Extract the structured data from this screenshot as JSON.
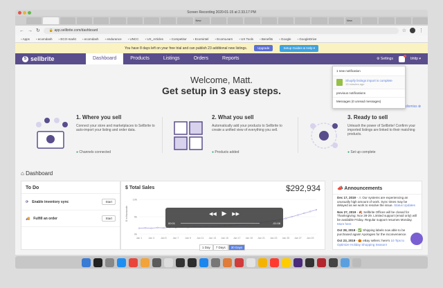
{
  "mac": {
    "window_title": "Screen Recording 2020-01-15 at 2.33.17 PM"
  },
  "browser": {
    "tabs": [
      "",
      "",
      "",
      "",
      "",
      "",
      "",
      "",
      "",
      "",
      "New",
      "",
      "",
      "",
      "",
      "",
      "",
      "",
      "",
      "New",
      "",
      "",
      "",
      ""
    ],
    "url": "app.sellbrite.com/dashboard",
    "bookmarks": [
      "Apps",
      "ecomdash",
      "ECO-markt",
      "ecomdash",
      "endurance",
      "UNCC",
      "UX_Articles",
      "Competitor",
      "Ecomintel",
      "EcomLearn",
      "UX Tools",
      "Benefits",
      "Google",
      "GoogleDrive"
    ]
  },
  "trial_banner": {
    "text": "You have 8 days left on your free trial and can publish 23 additional new listings.",
    "upgrade": "Upgrade",
    "setup": "Setup Guides & Help ▾"
  },
  "header": {
    "logo": "sellbrite",
    "nav": [
      "Dashboard",
      "Products",
      "Listings",
      "Orders",
      "Reports"
    ],
    "settings": "Settings",
    "user": "bhttp ▾"
  },
  "notifications": {
    "title": "1 new notification",
    "item": "Shopify listings import is complete",
    "item_time": "13 minutes ago",
    "link1": "previous notifications",
    "link2": "Messages (0 unread messages)",
    "dismiss": "dismiss ⊗"
  },
  "welcome": {
    "line1": "Welcome, Matt.",
    "line2": "Get setup in 3 easy steps."
  },
  "steps": [
    {
      "title": "1. Where you sell",
      "text": "Connect your store and marketplaces to Sellbrite to auto-import your listing and order data.",
      "status": "Channels connected"
    },
    {
      "title": "2. What you sell",
      "text": "Automatically add your products to Sellbrite to create a unified view of everything you sell.",
      "status": "Products added"
    },
    {
      "title": "3. Ready to sell",
      "text": "Unleash the power of Sellbrite! Confirm your imported listings are linked to their matching products.",
      "status": "Set up complete"
    }
  ],
  "dashboard": {
    "heading": "Dashboard"
  },
  "todo": {
    "title": "To Do",
    "items": [
      {
        "label": "Enable inventory sync",
        "button": "Start"
      },
      {
        "label": "Fulfill an order",
        "button": "Start"
      }
    ]
  },
  "sales": {
    "title": "$ Total Sales",
    "amount": "$292,934",
    "ylabel": "$ in thousands",
    "ranges": [
      "1 Day",
      "7 Days",
      "30 Days"
    ],
    "active_range": "30 Days",
    "player_start": "00:01",
    "player_end": "-01:08"
  },
  "chart_data": {
    "type": "line",
    "title": "$ Total Sales",
    "ylabel": "$ in thousands",
    "y_ticks": [
      "10k",
      "5k",
      "0k"
    ],
    "categories": [
      "Jan 1",
      "Jan 2",
      "Jan 3",
      "Jan 4",
      "Jan 5",
      "Jan 6",
      "Jan 7",
      "Jan 8",
      "Jan 9",
      "Jan 10",
      "Jan 11",
      "Jan 12",
      "Jan 13",
      "Jan 14",
      "Jan 15",
      "Jan 16",
      "Jan 17",
      "Jan 18",
      "Jan 19",
      "Jan 20",
      "Jan 21",
      "Jan 22",
      "Jan 23",
      "Jan 24",
      "Jan 25",
      "Jan 26",
      "Jan 27",
      "Jan 28",
      "Jan 29",
      "Jan 30"
    ],
    "x_ticks": [
      "Jan 1",
      "Jan 3",
      "Jan 5",
      "Jan 7",
      "Jan 9",
      "Jan 11",
      "Jan 13",
      "Jan 15",
      "Jan 17",
      "Jan 19",
      "Jan 21",
      "Jan 23",
      "Jan 25",
      "Jan 27",
      "Jan 29"
    ],
    "values": [
      2.0,
      2.1,
      2.0,
      2.2,
      2.1,
      2.3,
      2.2,
      2.4,
      2.3,
      2.5,
      2.4,
      2.6,
      2.5,
      2.7,
      2.9,
      3.0,
      3.2,
      3.4,
      3.6,
      3.8,
      4.0,
      4.3,
      4.6,
      5.0,
      5.4,
      6.0,
      6.6,
      7.2,
      7.8,
      8.4
    ],
    "ylim": [
      0,
      12
    ]
  },
  "announcements": {
    "title": "Announcements",
    "items": [
      {
        "date": "Dec 17, 2019",
        "text": "- ⚠ Our systems are experiencing an unusually high amount of work. Sync times may be delayed as we work to resolve the issue.",
        "link": "Status Updates"
      },
      {
        "date": "Nov 27, 2019",
        "text": "- 🍂 Sellbrite Offices will be closed for Thanksgiving: Nov 28-29. Limited support (email only) will be available Friday. Regular support resumes Monday.",
        "link": "More here"
      },
      {
        "date": "Oct 28, 2019",
        "text": "- ✅ Shipping labels now able to be purchased again! Apologies for the inconvenience.",
        "link": ""
      },
      {
        "date": "Oct 23, 2019",
        "text": "- 🎃 eBay sellers: here's",
        "link": "10 Tips to Optimize Holiday Shopping Season!"
      }
    ]
  },
  "colors": {
    "brand": "#5a4d8c",
    "accent": "#5b7fe0",
    "success": "#3aa37a",
    "banner": "#fbf2c2"
  }
}
